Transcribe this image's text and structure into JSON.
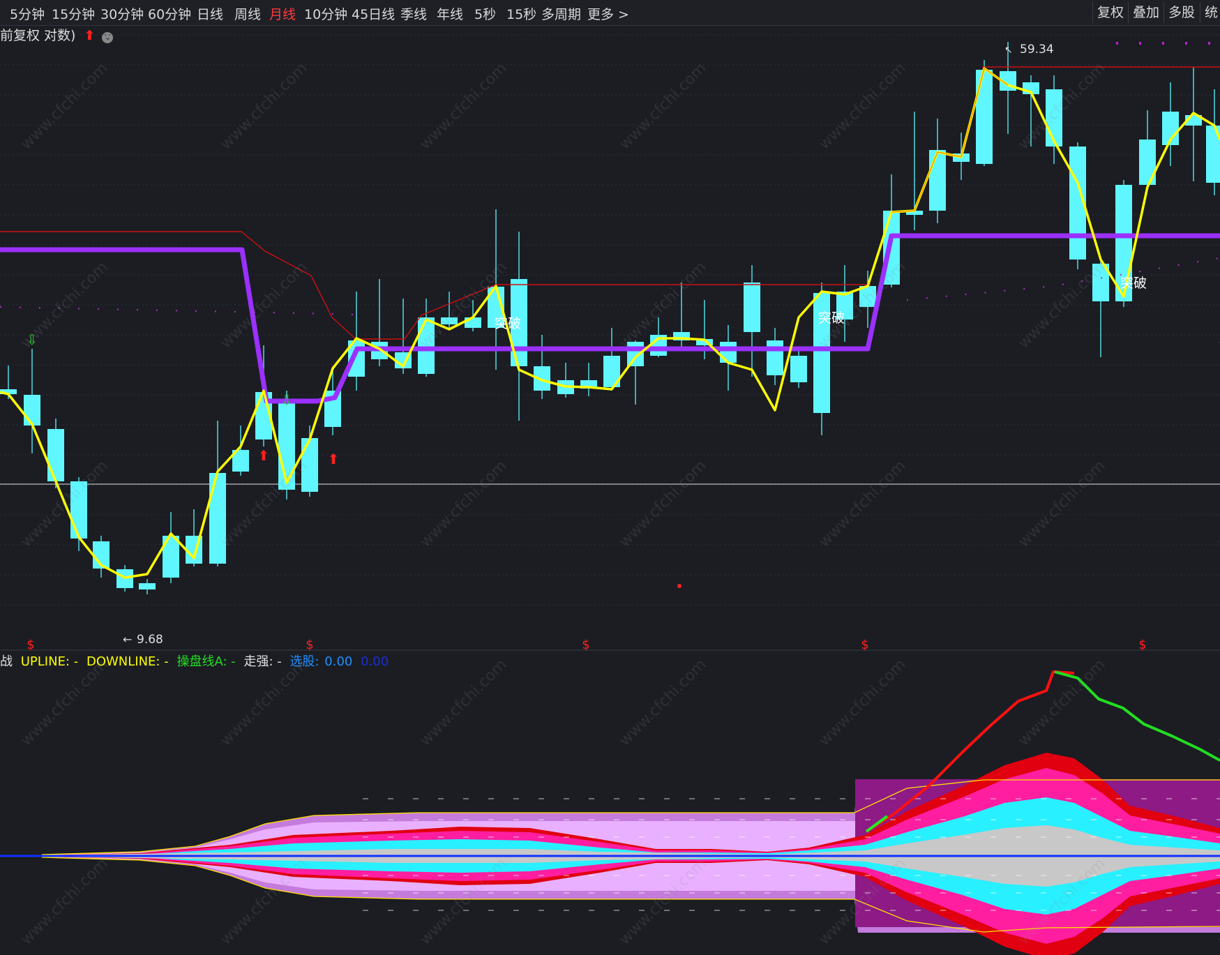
{
  "toolbar": {
    "tabs": [
      {
        "label": "5分钟",
        "active": false
      },
      {
        "label": "15分钟",
        "active": false
      },
      {
        "label": "30分钟",
        "active": false
      },
      {
        "label": "60分钟",
        "active": false
      },
      {
        "label": "日线",
        "active": false
      },
      {
        "label": "周线",
        "active": false
      },
      {
        "label": "月线",
        "active": true
      },
      {
        "label": "10分钟",
        "active": false
      },
      {
        "label": "45日线",
        "active": false
      },
      {
        "label": "季线",
        "active": false
      },
      {
        "label": "年线",
        "active": false
      },
      {
        "label": "5秒",
        "active": false
      },
      {
        "label": "15秒",
        "active": false
      },
      {
        "label": "多周期",
        "active": false
      },
      {
        "label": "更多 >",
        "active": false
      }
    ],
    "right_buttons": [
      "复权",
      "叠加",
      "多股",
      "统"
    ]
  },
  "main": {
    "subtitle": "前复权 对数)",
    "high_label": "59.34",
    "low_label": "9.68",
    "breakout_label": "突破"
  },
  "indicator": {
    "name": "战",
    "upline": "UPLINE: -",
    "downline": "DOWNLINE: -",
    "line_a": "操盘线A: -",
    "strong": "走强: -",
    "select_label": "选股:",
    "select_v1": "0.00",
    "select_v2": "0.00"
  },
  "colors": {
    "up": "#ff3b3b",
    "down": "#5ff6ff",
    "ma": "#ffff00",
    "support": "#9b30ff",
    "resistance": "#cc1010",
    "background": "#1b1d23"
  },
  "watermark": "www.cfchi.com"
}
